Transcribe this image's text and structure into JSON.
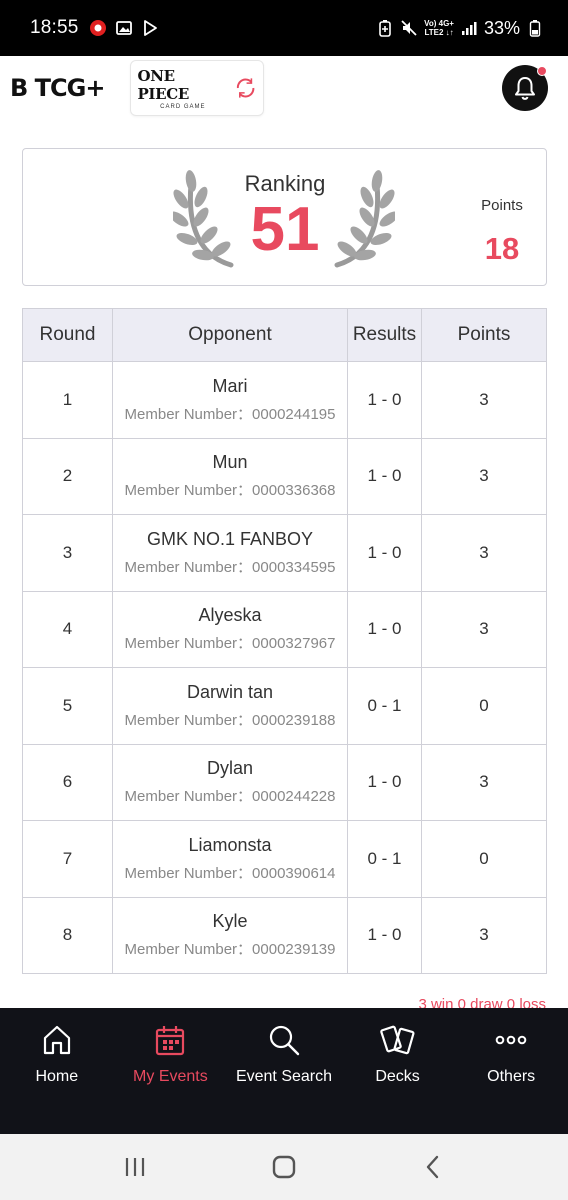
{
  "status_bar": {
    "time": "18:55",
    "network_top": "Vo) 4G+",
    "network_bottom": "LTE2 ↓↑",
    "battery": "33%"
  },
  "header": {
    "brand_logo": "B TCG+",
    "game_logo_main": "ONE PIECE",
    "game_logo_sub": "CARD GAME",
    "notification_icon": "bell-icon",
    "accent_color": "#e84a5f"
  },
  "ranking": {
    "label": "Ranking",
    "value": "51",
    "points_label": "Points",
    "points_value": "18"
  },
  "table": {
    "headers": {
      "round": "Round",
      "opponent": "Opponent",
      "results": "Results",
      "points": "Points"
    },
    "rows": [
      {
        "round": "1",
        "name": "Mari",
        "member": "Member Number：0000244195",
        "result": "1 - 0",
        "points": "3"
      },
      {
        "round": "2",
        "name": "Mun",
        "member": "Member Number：0000336368",
        "result": "1 - 0",
        "points": "3"
      },
      {
        "round": "3",
        "name": "GMK NO.1 FANBOY",
        "member": "Member Number：0000334595",
        "result": "1 - 0",
        "points": "3"
      },
      {
        "round": "4",
        "name": "Alyeska",
        "member": "Member Number：0000327967",
        "result": "1 - 0",
        "points": "3"
      },
      {
        "round": "5",
        "name": "Darwin tan",
        "member": "Member Number：0000239188",
        "result": "0 - 1",
        "points": "0"
      },
      {
        "round": "6",
        "name": "Dylan",
        "member": "Member Number：0000244228",
        "result": "1 - 0",
        "points": "3"
      },
      {
        "round": "7",
        "name": "Liamonsta",
        "member": "Member Number：0000390614",
        "result": "0 - 1",
        "points": "0"
      },
      {
        "round": "8",
        "name": "Kyle",
        "member": "Member Number：0000239139",
        "result": "1 - 0",
        "points": "3"
      }
    ]
  },
  "summary": "3 win   0 draw   0 loss",
  "bottom_nav": {
    "items": [
      {
        "label": "Home",
        "icon": "home-icon"
      },
      {
        "label": "My Events",
        "icon": "calendar-icon",
        "active": true
      },
      {
        "label": "Event Search",
        "icon": "search-icon"
      },
      {
        "label": "Decks",
        "icon": "cards-icon"
      },
      {
        "label": "Others",
        "icon": "more-icon"
      }
    ]
  }
}
